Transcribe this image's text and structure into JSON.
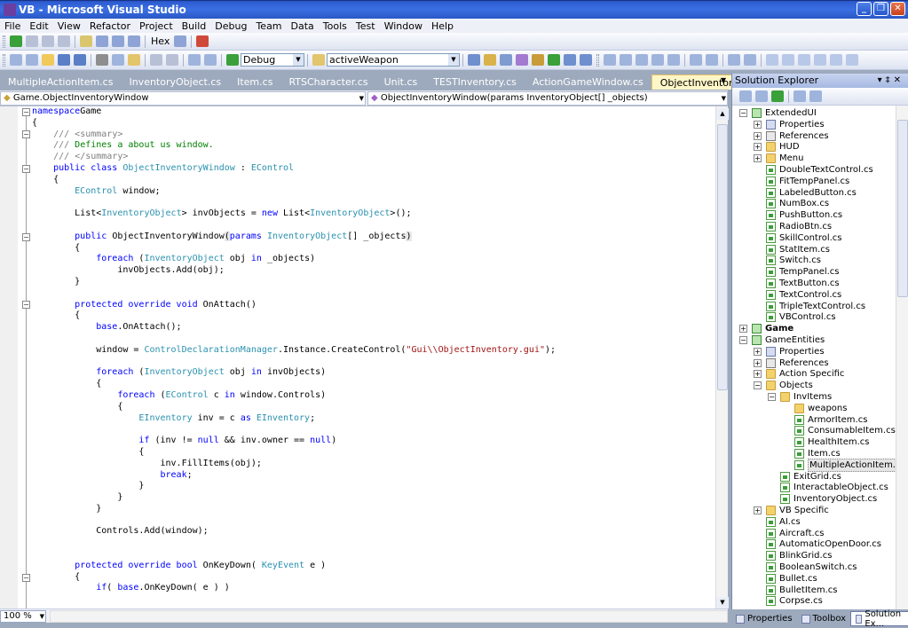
{
  "window": {
    "title": "VB - Microsoft Visual Studio"
  },
  "menu": [
    "File",
    "Edit",
    "View",
    "Refactor",
    "Project",
    "Build",
    "Debug",
    "Team",
    "Data",
    "Tools",
    "Test",
    "Window",
    "Help"
  ],
  "toolbar": {
    "hex_label": "Hex",
    "config": "Debug",
    "find_combo": "activeWeapon"
  },
  "tabs": [
    {
      "label": "MultipleActionItem.cs"
    },
    {
      "label": "InventoryObject.cs"
    },
    {
      "label": "Item.cs"
    },
    {
      "label": "RTSCharacter.cs"
    },
    {
      "label": "Unit.cs"
    },
    {
      "label": "TESTInventory.cs"
    },
    {
      "label": "ActionGameWindow.cs"
    },
    {
      "label": "ObjectInventory.cs",
      "active": true
    }
  ],
  "nav": {
    "class_combo": "Game.ObjectInventoryWindow",
    "member_combo": "ObjectInventoryWindow(params InventoryObject[] _objects)"
  },
  "editor": {
    "zoom": "100 %",
    "lines": [
      [
        [
          "kw",
          "namespace"
        ],
        [
          "",
          "Game"
        ]
      ],
      [
        [
          "",
          "{"
        ]
      ],
      [
        [
          "cm-g",
          "    /// "
        ],
        [
          "cm-g",
          "<summary>"
        ]
      ],
      [
        [
          "cm-g",
          "    /// "
        ],
        [
          "cm",
          "Defines a about us window."
        ]
      ],
      [
        [
          "cm-g",
          "    /// "
        ],
        [
          "cm-g",
          "</summary>"
        ]
      ],
      [
        [
          "kw",
          "    public class "
        ],
        [
          "ty",
          "ObjectInventoryWindow"
        ],
        [
          "",
          " : "
        ],
        [
          "ty",
          "EControl"
        ]
      ],
      [
        [
          "",
          "    {"
        ]
      ],
      [
        [
          "ty",
          "        EControl"
        ],
        [
          "",
          " window;"
        ]
      ],
      [
        [
          "",
          ""
        ]
      ],
      [
        [
          "",
          "        List<"
        ],
        [
          "ty",
          "InventoryObject"
        ],
        [
          "",
          "> invObjects = "
        ],
        [
          "kw",
          "new "
        ],
        [
          "",
          "List<"
        ],
        [
          "ty",
          "InventoryObject"
        ],
        [
          "",
          ">();"
        ]
      ],
      [
        [
          "",
          ""
        ]
      ],
      [
        [
          "kw",
          "        public "
        ],
        [
          "",
          "ObjectInventoryWindow"
        ],
        [
          "hl",
          "("
        ],
        [
          "kw",
          "params "
        ],
        [
          "ty",
          "InventoryObject"
        ],
        [
          "",
          "[] _objects"
        ],
        [
          "hl",
          ")"
        ]
      ],
      [
        [
          "",
          "        {"
        ]
      ],
      [
        [
          "kw",
          "            foreach "
        ],
        [
          "",
          "("
        ],
        [
          "ty",
          "InventoryObject"
        ],
        [
          "",
          " obj "
        ],
        [
          "kw",
          "in"
        ],
        [
          "",
          " _objects)"
        ]
      ],
      [
        [
          "",
          "                invObjects.Add(obj);"
        ]
      ],
      [
        [
          "",
          "        }"
        ]
      ],
      [
        [
          "",
          ""
        ]
      ],
      [
        [
          "kw",
          "        protected override void "
        ],
        [
          "",
          "OnAttach()"
        ]
      ],
      [
        [
          "",
          "        {"
        ]
      ],
      [
        [
          "kw",
          "            base"
        ],
        [
          "",
          ".OnAttach();"
        ]
      ],
      [
        [
          "",
          ""
        ]
      ],
      [
        [
          "",
          "            window = "
        ],
        [
          "ty",
          "ControlDeclarationManager"
        ],
        [
          "",
          ".Instance.CreateControl("
        ],
        [
          "st",
          "\"Gui\\\\ObjectInventory.gui\""
        ],
        [
          "",
          ");"
        ]
      ],
      [
        [
          "",
          ""
        ]
      ],
      [
        [
          "kw",
          "            foreach "
        ],
        [
          "",
          "("
        ],
        [
          "ty",
          "InventoryObject"
        ],
        [
          "",
          " obj "
        ],
        [
          "kw",
          "in"
        ],
        [
          "",
          " invObjects)"
        ]
      ],
      [
        [
          "",
          "            {"
        ]
      ],
      [
        [
          "kw",
          "                foreach "
        ],
        [
          "",
          "("
        ],
        [
          "ty",
          "EControl"
        ],
        [
          "",
          " c "
        ],
        [
          "kw",
          "in"
        ],
        [
          "",
          " window.Controls)"
        ]
      ],
      [
        [
          "",
          "                {"
        ]
      ],
      [
        [
          "ty",
          "                    EInventory"
        ],
        [
          "",
          " inv = c "
        ],
        [
          "kw",
          "as "
        ],
        [
          "ty",
          "EInventory"
        ],
        [
          "",
          ";"
        ]
      ],
      [
        [
          "",
          ""
        ]
      ],
      [
        [
          "kw",
          "                    if "
        ],
        [
          "",
          "(inv != "
        ],
        [
          "kw",
          "null"
        ],
        [
          "",
          " && inv.owner == "
        ],
        [
          "kw",
          "null"
        ],
        [
          "",
          ")"
        ]
      ],
      [
        [
          "",
          "                    {"
        ]
      ],
      [
        [
          "",
          "                        inv.FillItems(obj);"
        ]
      ],
      [
        [
          "kw",
          "                        break"
        ],
        [
          "",
          ";"
        ]
      ],
      [
        [
          "",
          "                    }"
        ]
      ],
      [
        [
          "",
          "                }"
        ]
      ],
      [
        [
          "",
          "            }"
        ]
      ],
      [
        [
          "",
          ""
        ]
      ],
      [
        [
          "",
          "            Controls.Add(window);"
        ]
      ],
      [
        [
          "",
          ""
        ]
      ],
      [
        [
          "",
          ""
        ]
      ],
      [
        [
          "kw",
          "        protected override bool "
        ],
        [
          "",
          "OnKeyDown( "
        ],
        [
          "ty",
          "KeyEvent"
        ],
        [
          "",
          " e )"
        ]
      ],
      [
        [
          "",
          "        {"
        ]
      ],
      [
        [
          "kw",
          "            if"
        ],
        [
          "",
          "( "
        ],
        [
          "kw",
          "base"
        ],
        [
          "",
          ".OnKeyDown( e ) )"
        ]
      ]
    ]
  },
  "solution_explorer": {
    "title": "Solution Explorer",
    "nodes": [
      {
        "label": "ExtendedUI",
        "type": "proj",
        "level": 0,
        "pm": "-"
      },
      {
        "label": "Properties",
        "type": "props",
        "level": 1,
        "pm": "+"
      },
      {
        "label": "References",
        "type": "refs",
        "level": 1,
        "pm": "+"
      },
      {
        "label": "HUD",
        "type": "folder",
        "level": 1,
        "pm": "+"
      },
      {
        "label": "Menu",
        "type": "folder",
        "level": 1,
        "pm": "+"
      },
      {
        "label": "DoubleTextControl.cs",
        "type": "file",
        "level": 1
      },
      {
        "label": "FitTempPanel.cs",
        "type": "file",
        "level": 1
      },
      {
        "label": "LabeledButton.cs",
        "type": "file",
        "level": 1
      },
      {
        "label": "NumBox.cs",
        "type": "file",
        "level": 1
      },
      {
        "label": "PushButton.cs",
        "type": "file",
        "level": 1
      },
      {
        "label": "RadioBtn.cs",
        "type": "file",
        "level": 1
      },
      {
        "label": "SkillControl.cs",
        "type": "file",
        "level": 1
      },
      {
        "label": "StatItem.cs",
        "type": "file",
        "level": 1
      },
      {
        "label": "Switch.cs",
        "type": "file",
        "level": 1
      },
      {
        "label": "TempPanel.cs",
        "type": "file",
        "level": 1
      },
      {
        "label": "TextButton.cs",
        "type": "file",
        "level": 1
      },
      {
        "label": "TextControl.cs",
        "type": "file",
        "level": 1
      },
      {
        "label": "TripleTextControl.cs",
        "type": "file",
        "level": 1
      },
      {
        "label": "VBControl.cs",
        "type": "file",
        "level": 1
      },
      {
        "label": "Game",
        "type": "proj",
        "level": 0,
        "pm": "+",
        "bold": true
      },
      {
        "label": "GameEntities",
        "type": "proj",
        "level": 0,
        "pm": "-"
      },
      {
        "label": "Properties",
        "type": "props",
        "level": 1,
        "pm": "+"
      },
      {
        "label": "References",
        "type": "refs",
        "level": 1,
        "pm": "+"
      },
      {
        "label": "Action Specific",
        "type": "folder",
        "level": 1,
        "pm": "+"
      },
      {
        "label": "Objects",
        "type": "folder",
        "level": 1,
        "pm": "-"
      },
      {
        "label": "InvItems",
        "type": "folder",
        "level": 2,
        "pm": "-"
      },
      {
        "label": "weapons",
        "type": "folder",
        "level": 3
      },
      {
        "label": "ArmorItem.cs",
        "type": "file",
        "level": 3
      },
      {
        "label": "ConsumableItem.cs",
        "type": "file",
        "level": 3
      },
      {
        "label": "HealthItem.cs",
        "type": "file",
        "level": 3
      },
      {
        "label": "Item.cs",
        "type": "file",
        "level": 3
      },
      {
        "label": "MultipleActionItem.cs",
        "type": "file",
        "level": 3,
        "selected": true
      },
      {
        "label": "ExitGrid.cs",
        "type": "file",
        "level": 2
      },
      {
        "label": "InteractableObject.cs",
        "type": "file",
        "level": 2
      },
      {
        "label": "InventoryObject.cs",
        "type": "file",
        "level": 2
      },
      {
        "label": "VB Specific",
        "type": "folder",
        "level": 1,
        "pm": "+"
      },
      {
        "label": "AI.cs",
        "type": "file",
        "level": 1
      },
      {
        "label": "Aircraft.cs",
        "type": "file",
        "level": 1
      },
      {
        "label": "AutomaticOpenDoor.cs",
        "type": "file",
        "level": 1
      },
      {
        "label": "BlinkGrid.cs",
        "type": "file",
        "level": 1
      },
      {
        "label": "BooleanSwitch.cs",
        "type": "file",
        "level": 1
      },
      {
        "label": "Bullet.cs",
        "type": "file",
        "level": 1
      },
      {
        "label": "BulletItem.cs",
        "type": "file",
        "level": 1
      },
      {
        "label": "Corpse.cs",
        "type": "file",
        "level": 1
      }
    ],
    "bottom_tabs": [
      "Properties",
      "Toolbox",
      "Solution Ex..."
    ]
  }
}
